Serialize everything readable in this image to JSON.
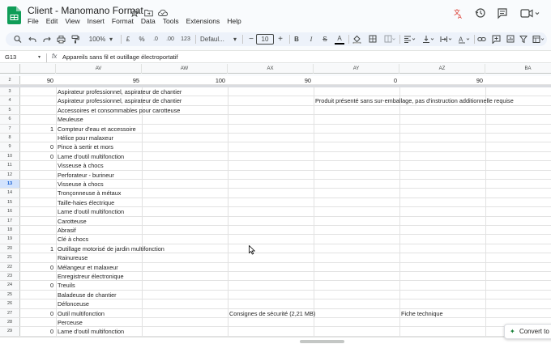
{
  "doc": {
    "title": "Client - Manomano Format",
    "menu": [
      "File",
      "Edit",
      "View",
      "Insert",
      "Format",
      "Data",
      "Tools",
      "Extensions",
      "Help"
    ]
  },
  "toolbar": {
    "zoom": "100%",
    "currency": "£",
    "percent": "%",
    "decimal_decrease": ".0",
    "decimal_increase": ".00",
    "number_format": "123",
    "font": "Defaul...",
    "font_size": "10",
    "bold": "B",
    "italic": "I",
    "strike": "S",
    "text_color": "A",
    "minus": "−",
    "plus": "+"
  },
  "formula_bar": {
    "cell_ref": "G13",
    "fx": "fx",
    "value": "Appareils sans fil et outillage électroportatif"
  },
  "columns": [
    "AV",
    "AW",
    "AX",
    "AY",
    "AZ",
    "BA"
  ],
  "frozen_row": {
    "num": "2",
    "values": [
      "90",
      "95",
      "100",
      "90",
      "0",
      "90"
    ]
  },
  "rows": [
    {
      "num": "3",
      "a": "",
      "b": "Aspirateur professionnel, aspirateur de chantier"
    },
    {
      "num": "4",
      "a": "",
      "b": "Aspirateur professionnel, aspirateur de chantier",
      "ay": "Produit présenté sans sur-emballage, pas d'instruction additionnelle requise"
    },
    {
      "num": "5",
      "a": "",
      "b": "Accessoires et consommables pour carotteuse"
    },
    {
      "num": "6",
      "a": "",
      "b": "Meuleuse"
    },
    {
      "num": "7",
      "a": "1",
      "b": "Compteur d'eau et accessoire"
    },
    {
      "num": "8",
      "a": "",
      "b": "Hélice pour malaxeur"
    },
    {
      "num": "9",
      "a": "0",
      "b": "Pince à sertir et mors"
    },
    {
      "num": "10",
      "a": "0",
      "b": "Lame d'outil multifonction"
    },
    {
      "num": "11",
      "a": "",
      "b": "Visseuse à chocs"
    },
    {
      "num": "12",
      "a": "",
      "b": "Perforateur - burineur"
    },
    {
      "num": "13",
      "a": "",
      "b": "Visseuse à chocs",
      "selected": true
    },
    {
      "num": "14",
      "a": "",
      "b": "Tronçonneuse à métaux"
    },
    {
      "num": "15",
      "a": "",
      "b": "Taille-haies électrique"
    },
    {
      "num": "16",
      "a": "",
      "b": "Lame d'outil multifonction"
    },
    {
      "num": "17",
      "a": "",
      "b": "Carotteuse"
    },
    {
      "num": "18",
      "a": "",
      "b": "Abrasif"
    },
    {
      "num": "19",
      "a": "",
      "b": "Clé à chocs"
    },
    {
      "num": "20",
      "a": "1",
      "b": "Outillage motorisé de jardin multifonction"
    },
    {
      "num": "21",
      "a": "",
      "b": "Rainureuse"
    },
    {
      "num": "22",
      "a": "0",
      "b": "Mélangeur et malaxeur"
    },
    {
      "num": "23",
      "a": "",
      "b": "Enregistreur électronique"
    },
    {
      "num": "24",
      "a": "0",
      "b": "Treuils"
    },
    {
      "num": "25",
      "a": "",
      "b": "Baladeuse de chantier"
    },
    {
      "num": "26",
      "a": "",
      "b": "Défonceuse"
    },
    {
      "num": "27",
      "a": "0",
      "b": "Outil multifonction",
      "ax": "Consignes de sécurité (2,21 MB)",
      "az": "Fiche technique"
    },
    {
      "num": "28",
      "a": "",
      "b": "Perceuse"
    },
    {
      "num": "29",
      "a": "0",
      "b": "Lame d'outil multifonction"
    }
  ],
  "convert_label": "Convert to"
}
